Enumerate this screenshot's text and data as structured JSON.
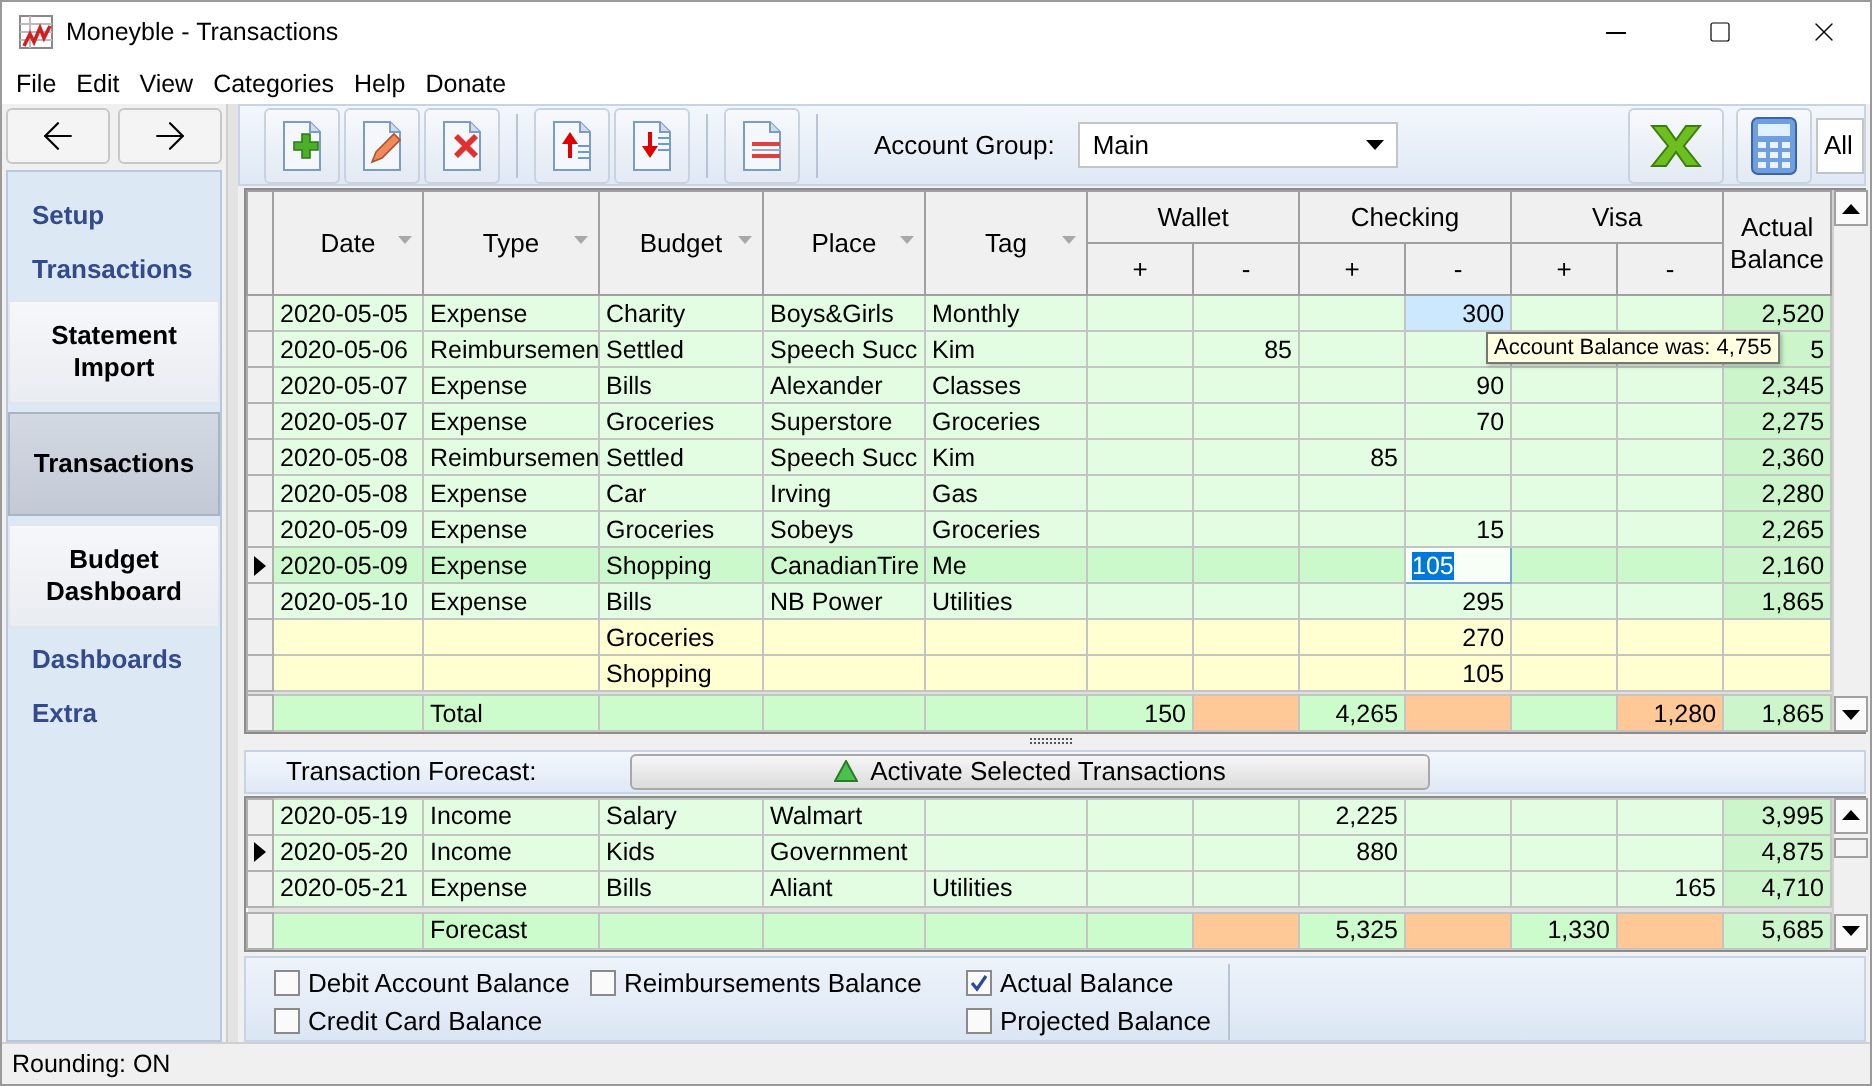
{
  "window": {
    "title": "Moneyble - Transactions"
  },
  "menu": [
    "File",
    "Edit",
    "View",
    "Categories",
    "Help",
    "Donate"
  ],
  "sidebar": {
    "items": [
      {
        "label": "Setup",
        "kind": "link",
        "selected": false
      },
      {
        "label": "Transactions",
        "kind": "link",
        "selected": false
      },
      {
        "label": "Statement Import",
        "kind": "button",
        "selected": false
      },
      {
        "label": "Transactions",
        "kind": "button",
        "selected": true
      },
      {
        "label": "Budget Dashboard",
        "kind": "button",
        "selected": false
      },
      {
        "label": "Dashboards",
        "kind": "link",
        "selected": false
      },
      {
        "label": "Extra",
        "kind": "link",
        "selected": false
      }
    ]
  },
  "toolbar": {
    "groups": [
      [
        {
          "kind": "add"
        },
        {
          "kind": "edit"
        },
        {
          "kind": "delete"
        }
      ],
      [
        {
          "kind": "move-up"
        },
        {
          "kind": "move-down"
        }
      ],
      [
        {
          "kind": "split"
        }
      ]
    ],
    "account_group_label": "Account Group:",
    "account_group": "Main",
    "filter_value": "All"
  },
  "table": {
    "text_columns": [
      "Date",
      "Type",
      "Budget",
      "Place",
      "Tag"
    ],
    "accounts": [
      "Wallet",
      "Checking",
      "Visa"
    ],
    "sub_columns": [
      {
        "label": "+",
        "kind": "in"
      },
      {
        "label": "-",
        "kind": "out"
      }
    ],
    "balance_column": "Actual Balance",
    "rows": [
      {
        "kind": "entry",
        "current": false,
        "selected": false,
        "date": "2020-05-05",
        "type": "Expense",
        "budget": "Charity",
        "place": "Boys&Girls",
        "tag": "Monthly",
        "amounts": [
          {
            "selected": false,
            "editing": false
          },
          {
            "selected": false,
            "editing": false
          },
          {
            "selected": false,
            "editing": false
          },
          {
            "text": "300",
            "selected": true,
            "editing": false
          },
          {
            "selected": false,
            "editing": false
          },
          {
            "selected": false,
            "editing": false
          }
        ],
        "balance": "2,520"
      },
      {
        "kind": "entry",
        "current": false,
        "selected": false,
        "date": "2020-05-06",
        "type": "Reimbursemen",
        "budget": "Settled",
        "place": "Speech Succ",
        "tag": "Kim",
        "amounts": [
          {
            "selected": false,
            "editing": false
          },
          {
            "text": "85",
            "selected": false,
            "editing": false
          },
          {
            "selected": false,
            "editing": false
          },
          {
            "selected": false,
            "editing": false
          },
          {
            "selected": false,
            "editing": false
          },
          {
            "selected": false,
            "editing": false
          }
        ],
        "balance": "5"
      },
      {
        "kind": "entry",
        "current": false,
        "selected": false,
        "date": "2020-05-07",
        "type": "Expense",
        "budget": "Bills",
        "place": "Alexander",
        "tag": "Classes",
        "amounts": [
          {
            "selected": false,
            "editing": false
          },
          {
            "selected": false,
            "editing": false
          },
          {
            "selected": false,
            "editing": false
          },
          {
            "text": "90",
            "selected": false,
            "editing": false
          },
          {
            "selected": false,
            "editing": false
          },
          {
            "selected": false,
            "editing": false
          }
        ],
        "balance": "2,345"
      },
      {
        "kind": "entry",
        "current": false,
        "selected": false,
        "date": "2020-05-07",
        "type": "Expense",
        "budget": "Groceries",
        "place": "Superstore",
        "tag": "Groceries",
        "amounts": [
          {
            "selected": false,
            "editing": false
          },
          {
            "selected": false,
            "editing": false
          },
          {
            "selected": false,
            "editing": false
          },
          {
            "text": "70",
            "selected": false,
            "editing": false
          },
          {
            "selected": false,
            "editing": false
          },
          {
            "selected": false,
            "editing": false
          }
        ],
        "balance": "2,275"
      },
      {
        "kind": "entry",
        "current": false,
        "selected": false,
        "date": "2020-05-08",
        "type": "Reimbursemen",
        "budget": "Settled",
        "place": "Speech Succ",
        "tag": "Kim",
        "amounts": [
          {
            "selected": false,
            "editing": false
          },
          {
            "selected": false,
            "editing": false
          },
          {
            "text": "85",
            "selected": false,
            "editing": false
          },
          {
            "selected": false,
            "editing": false
          },
          {
            "selected": false,
            "editing": false
          },
          {
            "selected": false,
            "editing": false
          }
        ],
        "balance": "2,360"
      },
      {
        "kind": "entry",
        "current": false,
        "selected": false,
        "date": "2020-05-08",
        "type": "Expense",
        "budget": "Car",
        "place": "Irving",
        "tag": "Gas",
        "amounts": [
          {
            "selected": false,
            "editing": false
          },
          {
            "selected": false,
            "editing": false
          },
          {
            "selected": false,
            "editing": false
          },
          {
            "selected": false,
            "editing": false
          },
          {
            "selected": false,
            "editing": false
          },
          {
            "selected": false,
            "editing": false
          }
        ],
        "balance": "2,280"
      },
      {
        "kind": "entry",
        "current": false,
        "selected": false,
        "date": "2020-05-09",
        "type": "Expense",
        "budget": "Groceries",
        "place": "Sobeys",
        "tag": "Groceries",
        "amounts": [
          {
            "selected": false,
            "editing": false
          },
          {
            "selected": false,
            "editing": false
          },
          {
            "selected": false,
            "editing": false
          },
          {
            "text": "15",
            "selected": false,
            "editing": false
          },
          {
            "selected": false,
            "editing": false
          },
          {
            "selected": false,
            "editing": false
          }
        ],
        "balance": "2,265"
      },
      {
        "kind": "entry",
        "current": true,
        "selected": true,
        "date": "2020-05-09",
        "type": "Expense",
        "budget": "Shopping",
        "place": "CanadianTire",
        "tag": "Me",
        "amounts": [
          {
            "selected": false,
            "editing": false
          },
          {
            "selected": false,
            "editing": false
          },
          {
            "selected": false,
            "editing": false
          },
          {
            "text": "105",
            "selected": false,
            "editing": true
          },
          {
            "selected": false,
            "editing": false
          },
          {
            "selected": false,
            "editing": false
          }
        ],
        "balance": "2,160"
      },
      {
        "kind": "entry",
        "current": false,
        "selected": false,
        "date": "2020-05-10",
        "type": "Expense",
        "budget": "Bills",
        "place": "NB Power",
        "tag": "Utilities",
        "amounts": [
          {
            "selected": false,
            "editing": false
          },
          {
            "selected": false,
            "editing": false
          },
          {
            "selected": false,
            "editing": false
          },
          {
            "text": "295",
            "selected": false,
            "editing": false
          },
          {
            "selected": false,
            "editing": false
          },
          {
            "selected": false,
            "editing": false
          }
        ],
        "balance": "1,865"
      },
      {
        "kind": "budget",
        "current": false,
        "selected": false,
        "budget": "Groceries",
        "amounts": [
          {
            "selected": false,
            "editing": false
          },
          {
            "selected": false,
            "editing": false
          },
          {
            "selected": false,
            "editing": false
          },
          {
            "text": "270",
            "selected": false,
            "editing": false
          },
          {
            "selected": false,
            "editing": false
          },
          {
            "selected": false,
            "editing": false
          }
        ]
      },
      {
        "kind": "budget",
        "current": false,
        "selected": false,
        "budget": "Shopping",
        "amounts": [
          {
            "selected": false,
            "editing": false
          },
          {
            "selected": false,
            "editing": false
          },
          {
            "selected": false,
            "editing": false
          },
          {
            "text": "105",
            "selected": false,
            "editing": false
          },
          {
            "selected": false,
            "editing": false
          },
          {
            "selected": false,
            "editing": false
          }
        ]
      }
    ],
    "total": {
      "type": "Total",
      "amounts": [
        {
          "text": "150",
          "selected": false,
          "editing": false
        },
        {
          "selected": false,
          "editing": false
        },
        {
          "text": "4,265",
          "selected": false,
          "editing": false
        },
        {
          "selected": false,
          "editing": false
        },
        {
          "selected": false,
          "editing": false
        },
        {
          "text": "1,280",
          "selected": false,
          "editing": false
        }
      ],
      "balance": "1,865"
    },
    "tooltip": "Account Balance was: 4,755"
  },
  "forecast": {
    "label": "Transaction Forecast:",
    "button": "Activate Selected Transactions",
    "rows": [
      {
        "current": false,
        "selected": false,
        "date": "2020-05-19",
        "type": "Income",
        "budget": "Salary",
        "place": "Walmart",
        "amounts": [
          {
            "selected": false,
            "editing": false
          },
          {
            "selected": false,
            "editing": false
          },
          {
            "text": "2,225",
            "selected": false,
            "editing": false
          },
          {
            "selected": false,
            "editing": false
          },
          {
            "selected": false,
            "editing": false
          },
          {
            "selected": false,
            "editing": false
          }
        ],
        "balance": "3,995"
      },
      {
        "current": true,
        "selected": false,
        "date": "2020-05-20",
        "type": "Income",
        "budget": "Kids",
        "place": "Government",
        "amounts": [
          {
            "selected": false,
            "editing": false
          },
          {
            "selected": false,
            "editing": false
          },
          {
            "text": "880",
            "selected": false,
            "editing": false
          },
          {
            "selected": false,
            "editing": false
          },
          {
            "selected": false,
            "editing": false
          },
          {
            "selected": false,
            "editing": false
          }
        ],
        "balance": "4,875"
      },
      {
        "current": false,
        "selected": false,
        "date": "2020-05-21",
        "type": "Expense",
        "budget": "Bills",
        "place": "Aliant",
        "tag": "Utilities",
        "amounts": [
          {
            "selected": false,
            "editing": false
          },
          {
            "selected": false,
            "editing": false
          },
          {
            "selected": false,
            "editing": false
          },
          {
            "selected": false,
            "editing": false
          },
          {
            "selected": false,
            "editing": false
          },
          {
            "text": "165",
            "selected": false,
            "editing": false
          }
        ],
        "balance": "4,710"
      }
    ],
    "total": {
      "type": "Forecast",
      "amounts": [
        {
          "selected": false,
          "editing": false
        },
        {
          "selected": false,
          "editing": false
        },
        {
          "text": "5,325",
          "selected": false,
          "editing": false
        },
        {
          "selected": false,
          "editing": false
        },
        {
          "text": "1,330",
          "selected": false,
          "editing": false
        },
        {
          "selected": false,
          "editing": false
        }
      ],
      "balance": "5,685"
    }
  },
  "balance_options": [
    [
      {
        "label": "Debit Account Balance",
        "checked": false
      },
      {
        "label": "Credit Card Balance",
        "checked": false
      }
    ],
    [
      {
        "label": "Reimbursements Balance",
        "checked": false
      }
    ],
    [
      {
        "label": "Actual Balance",
        "checked": true
      },
      {
        "label": "Projected Balance",
        "checked": false
      }
    ]
  ],
  "status_bar": "Rounding: ON"
}
